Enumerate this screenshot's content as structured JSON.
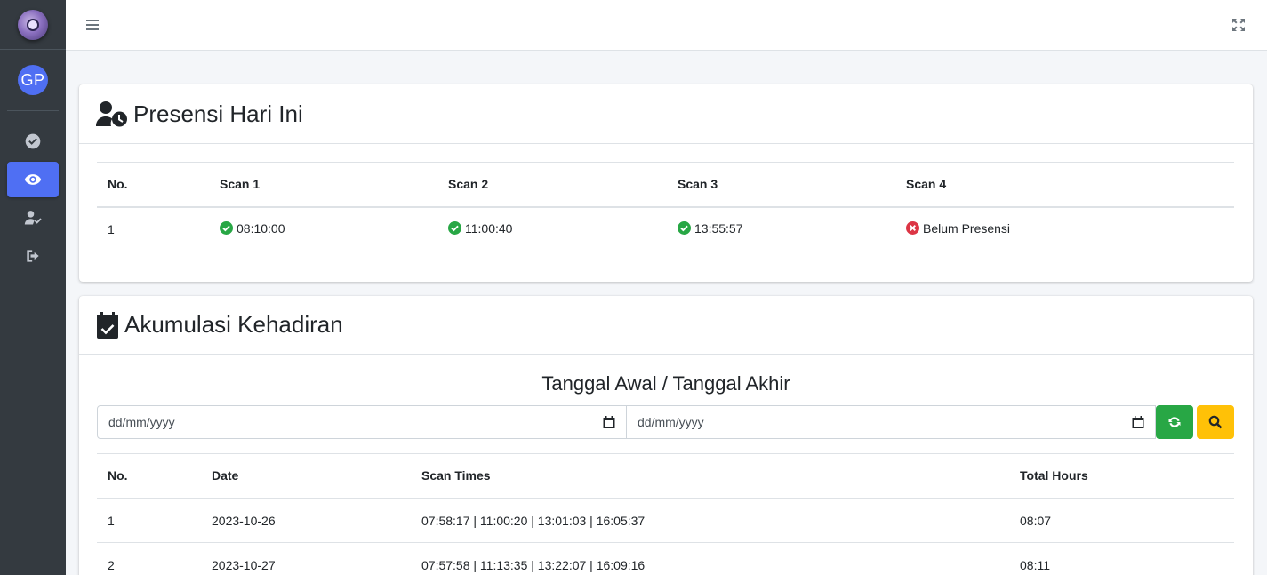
{
  "sidebar": {
    "user_initials": "GP",
    "items": [
      {
        "icon": "check-circle-icon"
      },
      {
        "icon": "eye-icon",
        "active": true
      },
      {
        "icon": "user-check-icon"
      },
      {
        "icon": "sign-out-icon"
      }
    ]
  },
  "presensi": {
    "title": "Presensi Hari Ini",
    "columns": [
      "No.",
      "Scan 1",
      "Scan 2",
      "Scan 3",
      "Scan 4"
    ],
    "row": {
      "no": "1",
      "scan1": "08:10:00",
      "scan2": "11:00:40",
      "scan3": "13:55:57",
      "scan4": "Belum Presensi"
    }
  },
  "akumulasi": {
    "title": "Akumulasi Kehadiran",
    "range_label": "Tanggal Awal / Tanggal Akhir",
    "start_placeholder": "dd/mm/yyyy",
    "end_placeholder": "dd/mm/yyyy",
    "columns": [
      "No.",
      "Date",
      "Scan Times",
      "Total Hours"
    ],
    "rows": [
      {
        "no": "1",
        "date": "2023-10-26",
        "scan_times": "07:58:17 | 11:00:20 | 13:01:03 | 16:05:37",
        "total_hours": "08:07"
      },
      {
        "no": "2",
        "date": "2023-10-27",
        "scan_times": "07:57:58 | 11:13:35 | 13:22:07 | 16:09:16",
        "total_hours": "08:11"
      }
    ]
  },
  "colors": {
    "accent": "#4f6ff3",
    "success": "#28a745",
    "danger": "#dc3545",
    "warning": "#ffc107",
    "sidebar": "#343a40"
  }
}
